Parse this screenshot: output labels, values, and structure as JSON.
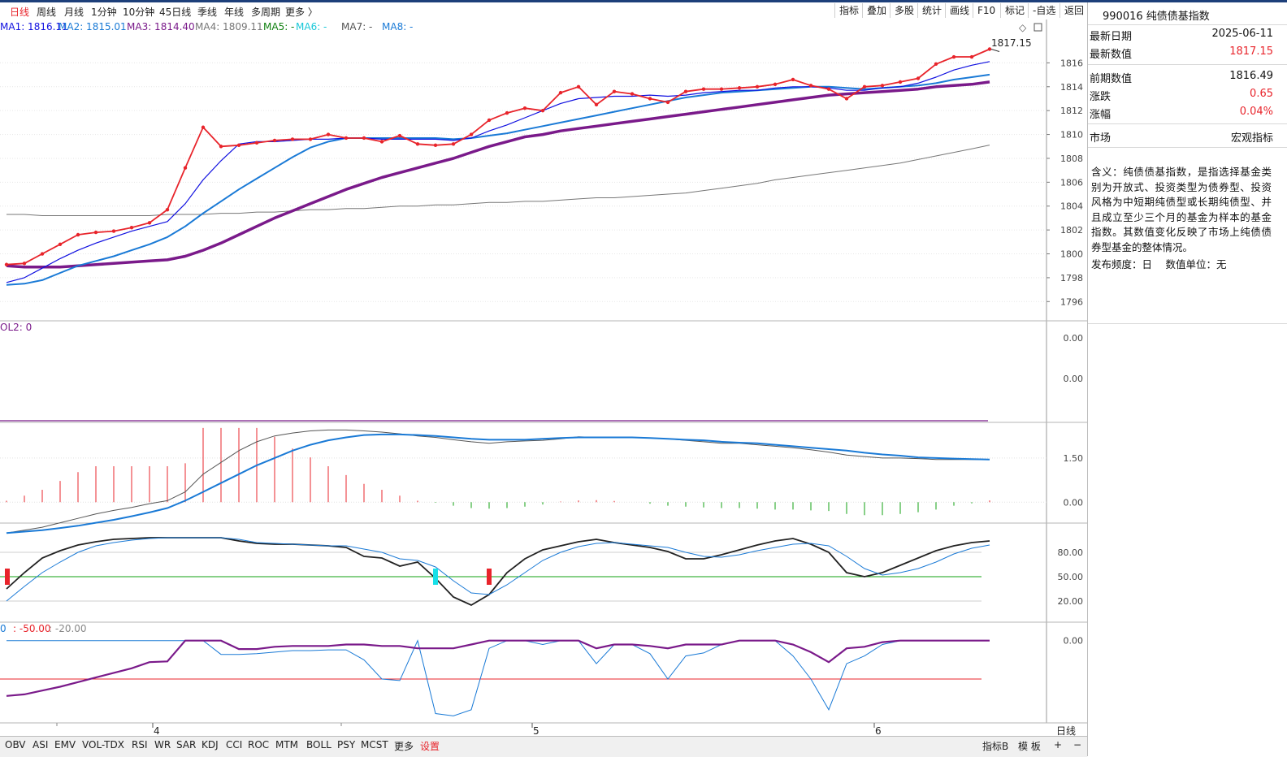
{
  "period_tabs": [
    {
      "label": "日线",
      "active": true
    },
    {
      "label": "周线"
    },
    {
      "label": "月线"
    },
    {
      "label": "1分钟"
    },
    {
      "label": "10分钟"
    },
    {
      "label": "45日线"
    },
    {
      "label": "季线"
    },
    {
      "label": "年线"
    },
    {
      "label": "多周期"
    },
    {
      "label": "更多 〉"
    }
  ],
  "toolbar": [
    "指标",
    "叠加",
    "多股",
    "统计",
    "画线",
    "F10",
    "标记",
    "-自选",
    "返回"
  ],
  "ma_legend": [
    {
      "label": "MA1: 1816.11",
      "color": "#1010e0"
    },
    {
      "label": "MA2: 1815.01",
      "color": "#1a7ad6"
    },
    {
      "label": "MA3: 1814.40",
      "color": "#7a1a8a"
    },
    {
      "label": "MA4: 1809.11",
      "color": "#777777"
    },
    {
      "label": "MA5: -",
      "color": "#108010"
    },
    {
      "label": "MA6: -",
      "color": "#18c8d8"
    },
    {
      "label": "MA7: -",
      "color": "#555555"
    },
    {
      "label": "MA8: -",
      "color": "#1a7ad6"
    }
  ],
  "vol_label": "OL2: 0",
  "wr_label": {
    "a": "0",
    "b": ": -50.00",
    "c": ": -20.00"
  },
  "bottom_tabs": [
    "OBV",
    "ASI",
    "EMV",
    "VOL-TDX",
    "RSI",
    "WR",
    "SAR",
    "KDJ",
    "CCI",
    "ROC",
    "MTM",
    "BOLL",
    "PSY",
    "MCST",
    "更多",
    "设置"
  ],
  "bottom_right": {
    "a": "指标B",
    "b": "模 板",
    "c": "+",
    "d": "−"
  },
  "x_axis_label": "日线",
  "panel": {
    "header": "990016 纯债债基指数",
    "rows": [
      {
        "k": "最新日期",
        "v": "2025-06-11",
        "red": false
      },
      {
        "k": "最新数值",
        "v": "1817.15",
        "red": true
      },
      {
        "k": "前期数值",
        "v": "1816.49",
        "red": false
      },
      {
        "k": "涨跌",
        "v": "0.65",
        "red": true
      },
      {
        "k": "涨幅",
        "v": "0.04%",
        "red": true
      },
      {
        "k": "市场",
        "v": "宏观指标",
        "red": false
      }
    ],
    "description": "含义：纯债债基指数，是指选择基金类别为开放式、投资类型为债券型、投资风格为中短期纯债型或长期纯债型、并且成立至少三个月的基金为样本的基金指数。其数值变化反映了市场上纯债债券型基金的整体情况。",
    "frequency": "发布频度：日　 数值单位：无"
  },
  "chart_data": [
    {
      "type": "line",
      "title": "",
      "annotation": "1817.15",
      "x_ticks": [
        {
          "label": "4",
          "index": 8
        },
        {
          "label": "5",
          "index": 29
        },
        {
          "label": "6",
          "index": 48
        }
      ],
      "ylim": [
        1795,
        1818
      ],
      "y_ticks": [
        1796,
        1798,
        1800,
        1802,
        1804,
        1806,
        1808,
        1810,
        1812,
        1814,
        1816
      ],
      "grid": true,
      "series": [
        {
          "name": "",
          "color": "#e8242b",
          "values": [
            1799.1,
            1799.2,
            1800.0,
            1800.8,
            1801.6,
            1801.8,
            1801.9,
            1802.2,
            1802.6,
            1803.7,
            1807.2,
            1810.6,
            1809.0,
            1809.1,
            1809.3,
            1809.5,
            1809.6,
            1809.6,
            1810.0,
            1809.7,
            1809.7,
            1809.4,
            1809.9,
            1809.2,
            1809.1,
            1809.2,
            1810.0,
            1811.2,
            1811.8,
            1812.2,
            1812.0,
            1813.5,
            1814.0,
            1812.5,
            1813.6,
            1813.4,
            1813.0,
            1812.7,
            1813.6,
            1813.8,
            1813.8,
            1813.9,
            1814.0,
            1814.2,
            1814.6,
            1814.1,
            1813.8,
            1813.0,
            1814.0,
            1814.1,
            1814.4,
            1814.7,
            1815.9,
            1816.5,
            1816.5,
            1817.15
          ]
        },
        {
          "name": "MA1",
          "color": "#1010e0",
          "values": [
            1797.6,
            1798.0,
            1798.8,
            1799.6,
            1800.3,
            1800.9,
            1801.4,
            1801.9,
            1802.3,
            1802.7,
            1804.2,
            1806.2,
            1807.8,
            1809.2,
            1809.4,
            1809.4,
            1809.5,
            1809.6,
            1809.6,
            1809.7,
            1809.7,
            1809.6,
            1809.6,
            1809.6,
            1809.6,
            1809.5,
            1809.7,
            1810.3,
            1810.8,
            1811.4,
            1812.0,
            1812.6,
            1813.0,
            1813.1,
            1813.2,
            1813.2,
            1813.3,
            1813.2,
            1813.3,
            1813.5,
            1813.6,
            1813.7,
            1813.7,
            1813.9,
            1814.0,
            1814.0,
            1813.9,
            1813.7,
            1813.7,
            1813.9,
            1814.0,
            1814.3,
            1814.8,
            1815.4,
            1815.8,
            1816.11
          ]
        },
        {
          "name": "MA2",
          "color": "#1a7ad6",
          "values": [
            1797.4,
            1797.5,
            1797.8,
            1798.4,
            1799.0,
            1799.4,
            1799.8,
            1800.3,
            1800.8,
            1801.4,
            1802.3,
            1803.4,
            1804.4,
            1805.4,
            1806.3,
            1807.2,
            1808.1,
            1808.9,
            1809.4,
            1809.7,
            1809.7,
            1809.7,
            1809.7,
            1809.7,
            1809.7,
            1809.6,
            1809.7,
            1809.9,
            1810.1,
            1810.4,
            1810.7,
            1811.0,
            1811.3,
            1811.6,
            1811.9,
            1812.2,
            1812.5,
            1812.8,
            1813.1,
            1813.3,
            1813.5,
            1813.6,
            1813.7,
            1813.8,
            1813.9,
            1814.0,
            1814.0,
            1813.9,
            1813.8,
            1813.9,
            1814.0,
            1814.1,
            1814.3,
            1814.6,
            1814.8,
            1815.01
          ]
        },
        {
          "name": "MA3",
          "color": "#7a1a8a",
          "values": [
            1799.0,
            1798.9,
            1798.9,
            1798.9,
            1799.0,
            1799.1,
            1799.2,
            1799.3,
            1799.4,
            1799.5,
            1799.8,
            1800.3,
            1800.9,
            1801.6,
            1802.3,
            1803.0,
            1803.6,
            1804.2,
            1804.8,
            1805.4,
            1805.9,
            1806.4,
            1806.8,
            1807.2,
            1807.6,
            1808.0,
            1808.5,
            1809.0,
            1809.4,
            1809.8,
            1810.0,
            1810.3,
            1810.5,
            1810.7,
            1810.9,
            1811.1,
            1811.3,
            1811.5,
            1811.7,
            1811.9,
            1812.1,
            1812.3,
            1812.5,
            1812.7,
            1812.9,
            1813.1,
            1813.3,
            1813.4,
            1813.5,
            1813.6,
            1813.7,
            1813.8,
            1814.0,
            1814.1,
            1814.2,
            1814.4
          ]
        },
        {
          "name": "MA4",
          "color": "#777777",
          "values": [
            1803.3,
            1803.3,
            1803.2,
            1803.2,
            1803.2,
            1803.2,
            1803.2,
            1803.2,
            1803.2,
            1803.3,
            1803.3,
            1803.3,
            1803.4,
            1803.4,
            1803.5,
            1803.5,
            1803.6,
            1803.7,
            1803.7,
            1803.8,
            1803.8,
            1803.9,
            1804.0,
            1804.0,
            1804.1,
            1804.1,
            1804.2,
            1804.3,
            1804.3,
            1804.4,
            1804.4,
            1804.5,
            1804.6,
            1804.7,
            1804.7,
            1804.8,
            1804.9,
            1805.0,
            1805.1,
            1805.3,
            1805.5,
            1805.7,
            1805.9,
            1806.2,
            1806.4,
            1806.6,
            1806.8,
            1807.0,
            1807.2,
            1807.4,
            1807.6,
            1807.9,
            1808.2,
            1808.5,
            1808.8,
            1809.11
          ]
        }
      ]
    },
    {
      "type": "line",
      "y_ticks": [
        "0.00",
        "0.00"
      ]
    },
    {
      "type": "bar",
      "y_ticks": [
        "1.50",
        "0.00"
      ],
      "ylim": [
        -0.6,
        2.6
      ],
      "bars": [
        0.05,
        0.22,
        0.42,
        0.72,
        1.02,
        1.22,
        1.22,
        1.22,
        1.22,
        1.22,
        1.32,
        2.52,
        2.52,
        2.52,
        2.52,
        2.22,
        1.82,
        1.52,
        1.22,
        0.92,
        0.62,
        0.42,
        0.22,
        0.05,
        -0.02,
        -0.12,
        -0.2,
        -0.22,
        -0.2,
        -0.15,
        -0.08,
        0.02,
        0.06,
        0.07,
        0.04,
        0.0,
        -0.05,
        -0.12,
        -0.15,
        -0.18,
        -0.2,
        -0.2,
        -0.22,
        -0.25,
        -0.25,
        -0.28,
        -0.3,
        -0.4,
        -0.44,
        -0.44,
        -0.4,
        -0.34,
        -0.25,
        -0.12,
        -0.04,
        0.06
      ],
      "series": [
        {
          "name": "",
          "color": "#555555",
          "values": [
            -1.05,
            -0.95,
            -0.85,
            -0.7,
            -0.55,
            -0.4,
            -0.28,
            -0.18,
            -0.05,
            0.05,
            0.35,
            0.95,
            1.35,
            1.75,
            2.05,
            2.25,
            2.35,
            2.42,
            2.45,
            2.45,
            2.42,
            2.38,
            2.32,
            2.25,
            2.2,
            2.12,
            2.05,
            2.0,
            2.05,
            2.08,
            2.1,
            2.15,
            2.22,
            2.2,
            2.2,
            2.2,
            2.18,
            2.15,
            2.1,
            2.05,
            2.0,
            2.0,
            1.95,
            1.9,
            1.85,
            1.78,
            1.7,
            1.6,
            1.55,
            1.5,
            1.5,
            1.48,
            1.45,
            1.45,
            1.45,
            1.45
          ]
        },
        {
          "name": "",
          "color": "#1a7ad6",
          "values": [
            -1.05,
            -1.0,
            -0.95,
            -0.88,
            -0.8,
            -0.7,
            -0.6,
            -0.48,
            -0.35,
            -0.2,
            0.05,
            0.35,
            0.65,
            0.95,
            1.25,
            1.5,
            1.75,
            1.95,
            2.1,
            2.2,
            2.28,
            2.3,
            2.3,
            2.28,
            2.25,
            2.2,
            2.15,
            2.12,
            2.12,
            2.12,
            2.15,
            2.18,
            2.2,
            2.2,
            2.2,
            2.2,
            2.18,
            2.15,
            2.12,
            2.1,
            2.05,
            2.02,
            2.0,
            1.95,
            1.9,
            1.85,
            1.8,
            1.75,
            1.68,
            1.62,
            1.58,
            1.52,
            1.5,
            1.48,
            1.46,
            1.45
          ]
        }
      ]
    },
    {
      "type": "line",
      "y_ticks": [
        "80.00",
        "50.00",
        "20.00"
      ],
      "ylim": [
        0,
        110
      ],
      "series": [
        {
          "name": "",
          "color": "#222222",
          "values": [
            35,
            55,
            73,
            82,
            89,
            93,
            96,
            97,
            98,
            98,
            98,
            98,
            98,
            94,
            91,
            90,
            90,
            89,
            88,
            86,
            75,
            73,
            63,
            68,
            48,
            25,
            15,
            28,
            55,
            72,
            83,
            88,
            93,
            96,
            92,
            89,
            86,
            81,
            72,
            72,
            77,
            83,
            89,
            94,
            97,
            90,
            80,
            55,
            50,
            55,
            64,
            73,
            82,
            88,
            92,
            94
          ]
        },
        {
          "name": "",
          "color": "#1a7ad6",
          "values": [
            20,
            38,
            55,
            68,
            80,
            88,
            92,
            95,
            97,
            98,
            98,
            98,
            98,
            96,
            92,
            91,
            90,
            89,
            88,
            88,
            84,
            80,
            72,
            70,
            62,
            45,
            30,
            28,
            40,
            55,
            70,
            80,
            87,
            91,
            92,
            90,
            88,
            86,
            80,
            75,
            74,
            77,
            82,
            86,
            90,
            91,
            88,
            75,
            60,
            52,
            55,
            60,
            68,
            78,
            85,
            89
          ]
        }
      ],
      "markers": [
        {
          "index": 0,
          "color": "#e8242b"
        },
        {
          "index": 24,
          "color": "#18e0e8"
        },
        {
          "index": 27,
          "color": "#e8242b"
        }
      ]
    },
    {
      "type": "line",
      "y_ticks": [
        "0.00"
      ],
      "ylim": [
        -105,
        5
      ],
      "series": [
        {
          "name": "",
          "color": "#1a7ad6",
          "values": [
            0,
            0,
            0,
            0,
            0,
            0,
            0,
            0,
            0,
            0,
            0,
            0,
            -18,
            -18,
            -17,
            -15,
            -13,
            -13,
            -12,
            -12,
            -25,
            -50,
            -52,
            0,
            -95,
            -98,
            -90,
            -10,
            0,
            0,
            -5,
            0,
            0,
            -30,
            -5,
            -5,
            -17,
            -50,
            -20,
            -16,
            -5,
            0,
            0,
            0,
            -20,
            -50,
            -90,
            -30,
            -20,
            -5,
            0,
            0,
            0,
            0,
            0,
            0
          ]
        },
        {
          "name": "",
          "color": "#7a1a8a",
          "values": [
            -72,
            -70,
            -65,
            -60,
            -54,
            -48,
            -42,
            -36,
            -28,
            -27,
            0,
            0,
            0,
            -11,
            -11,
            -8,
            -7,
            -7,
            -7,
            -5,
            -5,
            -7,
            -7,
            -10,
            -10,
            -10,
            -5,
            0,
            0,
            0,
            0,
            0,
            0,
            -10,
            -5,
            -5,
            -7,
            -10,
            -5,
            -5,
            -5,
            0,
            0,
            0,
            -5,
            -15,
            -28,
            -10,
            -8,
            -2,
            0,
            0,
            0,
            0,
            0,
            0
          ]
        }
      ]
    }
  ]
}
